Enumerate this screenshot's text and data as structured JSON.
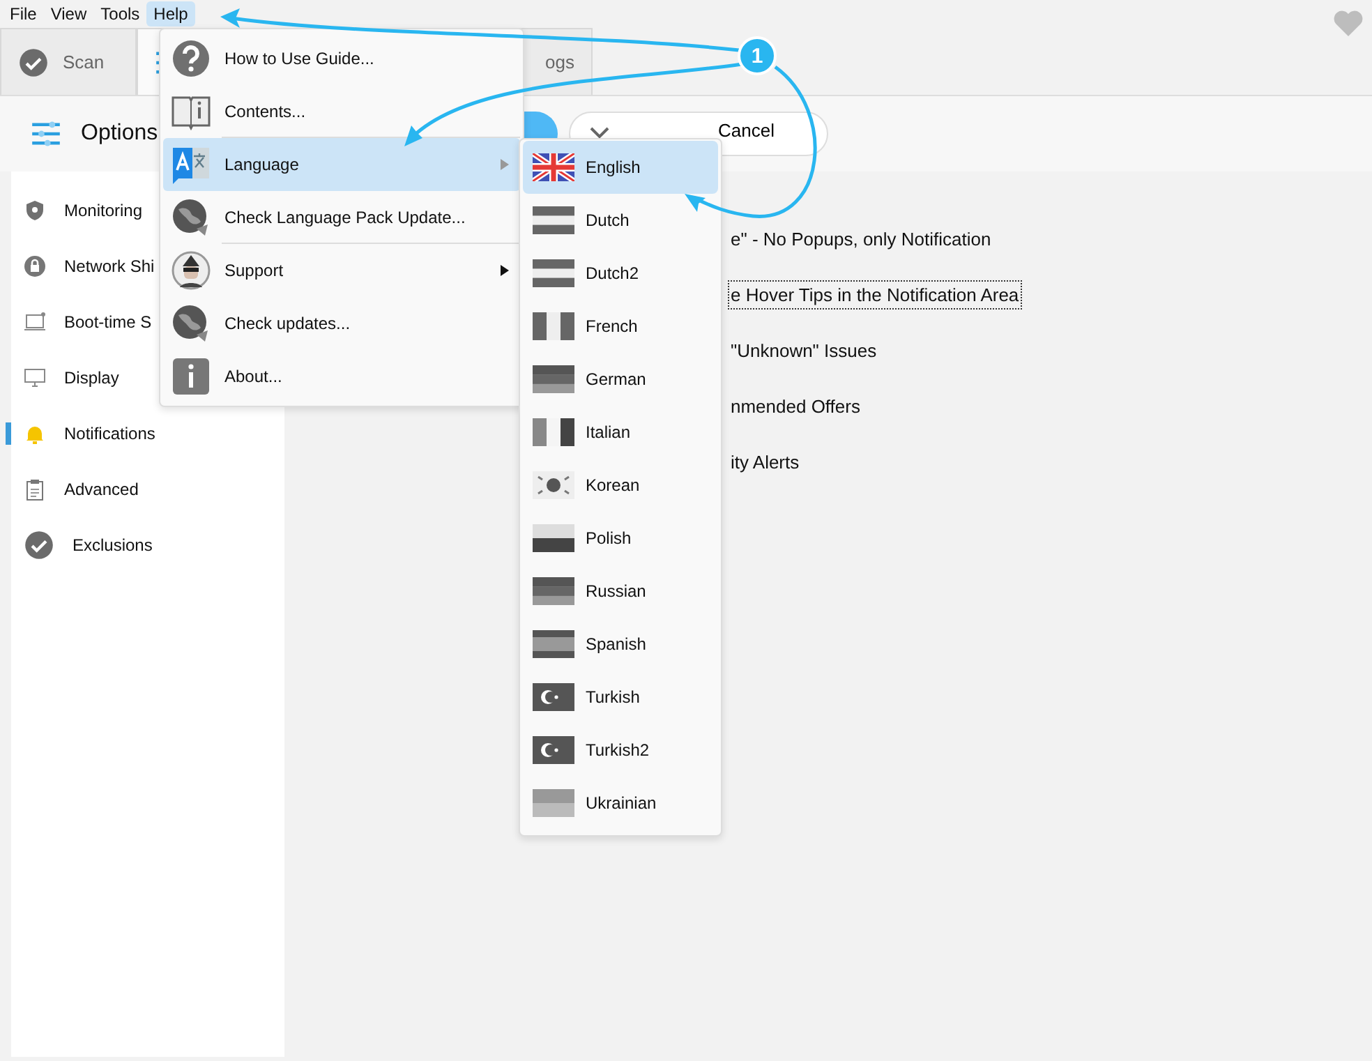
{
  "menu_bar": [
    {
      "label": "File",
      "selected": false
    },
    {
      "label": "View",
      "selected": false
    },
    {
      "label": "Tools",
      "selected": false
    },
    {
      "label": "Help",
      "selected": true
    }
  ],
  "tabs": [
    {
      "label": "Scan",
      "kind": "check",
      "selected": false
    },
    {
      "kind": "sliders",
      "selected": true
    },
    {
      "label": "ogs",
      "kind": "none",
      "selected": false
    }
  ],
  "sidebar": {
    "title": "Options",
    "items": [
      {
        "label": "Monitoring",
        "kind": "shield",
        "selected": false
      },
      {
        "label": "Network Shi",
        "kind": "lock",
        "selected": false
      },
      {
        "label": "Boot-time S",
        "kind": "laptop",
        "selected": false
      },
      {
        "label": "Display",
        "kind": "monitor",
        "selected": false
      },
      {
        "label": "Notifications",
        "kind": "bell",
        "selected": true
      },
      {
        "label": "Advanced",
        "kind": "clipboard",
        "selected": false
      },
      {
        "label": "Exclusions",
        "kind": "check",
        "selected": false
      }
    ]
  },
  "toolbar": {
    "cancel": "Cancel"
  },
  "options": [
    {
      "label": "e\" - No Popups, only Notification",
      "focused": false
    },
    {
      "label": "e Hover Tips in the Notification Area",
      "focused": true
    },
    {
      "label": "\"Unknown\" Issues",
      "focused": false
    },
    {
      "label": "nmended Offers",
      "focused": false
    },
    {
      "label": "ity Alerts",
      "focused": false
    }
  ],
  "help_menu": [
    {
      "label": "How to Use Guide...",
      "kind": "question",
      "selected": false,
      "submenu": false,
      "separator_after": false
    },
    {
      "label": "Contents...",
      "kind": "book",
      "selected": false,
      "submenu": false,
      "separator_after": true
    },
    {
      "label": "Language",
      "kind": "translate",
      "selected": true,
      "submenu": true,
      "separator_after": false
    },
    {
      "label": "Check Language Pack Update...",
      "kind": "globe",
      "selected": false,
      "submenu": false,
      "separator_after": true
    },
    {
      "label": "Support",
      "kind": "avatar",
      "selected": false,
      "submenu": true,
      "separator_after": false
    },
    {
      "label": "Check updates...",
      "kind": "globe",
      "selected": false,
      "submenu": false,
      "separator_after": false
    },
    {
      "label": "About...",
      "kind": "info",
      "selected": false,
      "submenu": false,
      "separator_after": false
    }
  ],
  "language_menu": [
    {
      "label": "English",
      "kind": "union",
      "selected": true
    },
    {
      "label": "Dutch",
      "kind": "hstripes",
      "selected": false
    },
    {
      "label": "Dutch2",
      "kind": "hstripes",
      "selected": false
    },
    {
      "label": "French",
      "kind": "vstripes",
      "selected": false
    },
    {
      "label": "German",
      "kind": "hstripes2",
      "selected": false
    },
    {
      "label": "Italian",
      "kind": "vstripes2",
      "selected": false
    },
    {
      "label": "Korean",
      "kind": "emblem",
      "selected": false
    },
    {
      "label": "Polish",
      "kind": "bicolor",
      "selected": false
    },
    {
      "label": "Russian",
      "kind": "hstripes2",
      "selected": false
    },
    {
      "label": "Spanish",
      "kind": "band",
      "selected": false
    },
    {
      "label": "Turkish",
      "kind": "crescent",
      "selected": false
    },
    {
      "label": "Turkish2",
      "kind": "crescent",
      "selected": false
    },
    {
      "label": "Ukrainian",
      "kind": "bicolor2",
      "selected": false
    }
  ],
  "callout": {
    "number": "1"
  }
}
